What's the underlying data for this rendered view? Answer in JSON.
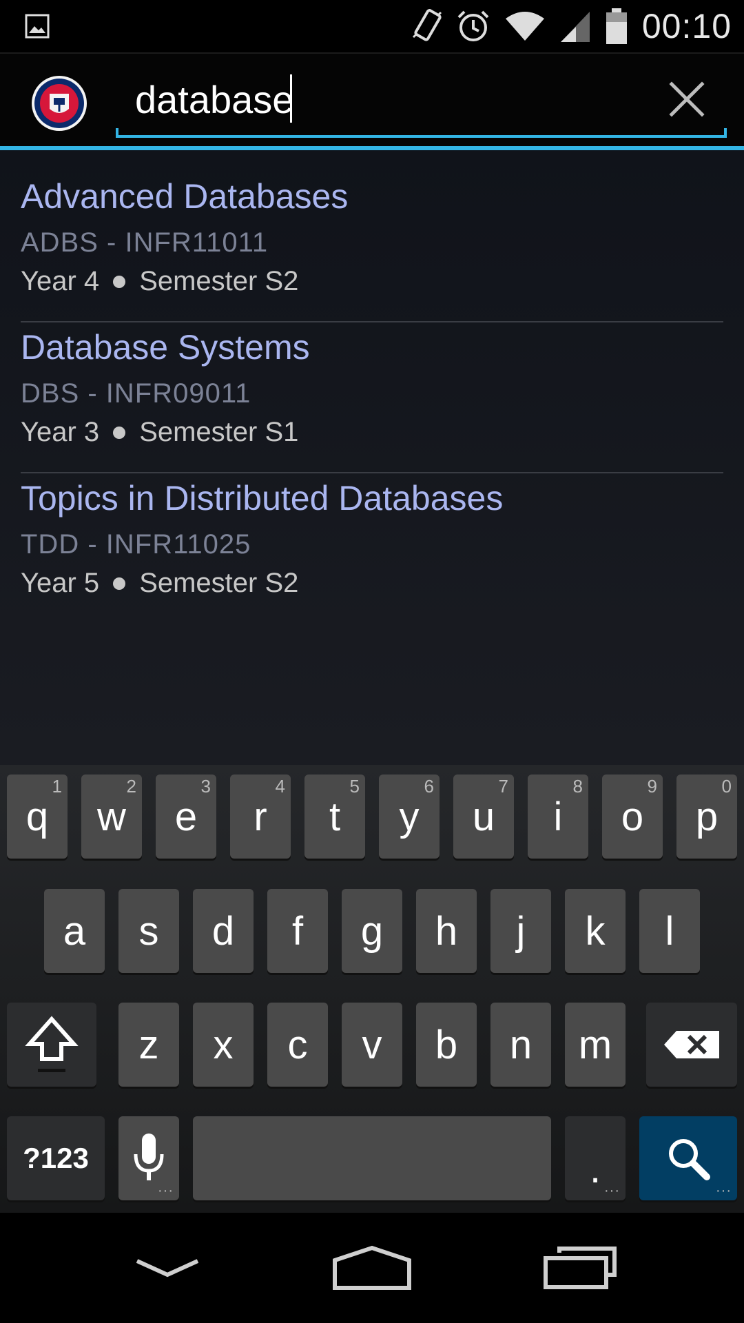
{
  "status_bar": {
    "time": "00:10",
    "icons": [
      "image-notification-icon",
      "vibrate-icon",
      "alarm-icon",
      "wifi-icon",
      "cell-signal-icon",
      "battery-icon"
    ]
  },
  "action_bar": {
    "logo": "university-of-edinburgh-crest",
    "search": {
      "value": "database",
      "placeholder": ""
    },
    "clear_icon": "close-icon",
    "accent_color": "#33b5e5"
  },
  "results": [
    {
      "title": "Advanced Databases",
      "code": "ADBS - INFR11011",
      "year": "Year 4",
      "semester": "Semester S2"
    },
    {
      "title": "Database Systems",
      "code": "DBS - INFR09011",
      "year": "Year 3",
      "semester": "Semester S1"
    },
    {
      "title": "Topics in Distributed Databases",
      "code": "TDD - INFR11025",
      "year": "Year 5",
      "semester": "Semester S2"
    }
  ],
  "keyboard": {
    "row1": [
      {
        "k": "q",
        "h": "1"
      },
      {
        "k": "w",
        "h": "2"
      },
      {
        "k": "e",
        "h": "3"
      },
      {
        "k": "r",
        "h": "4"
      },
      {
        "k": "t",
        "h": "5"
      },
      {
        "k": "y",
        "h": "6"
      },
      {
        "k": "u",
        "h": "7"
      },
      {
        "k": "i",
        "h": "8"
      },
      {
        "k": "o",
        "h": "9"
      },
      {
        "k": "p",
        "h": "0"
      }
    ],
    "row2": [
      "a",
      "s",
      "d",
      "f",
      "g",
      "h",
      "j",
      "k",
      "l"
    ],
    "row3": [
      "z",
      "x",
      "c",
      "v",
      "b",
      "n",
      "m"
    ],
    "symbols_label": "?123",
    "period_label": ".",
    "search_key_color": "#023e63"
  },
  "nav_bar": {
    "icons": [
      "back-icon",
      "home-icon",
      "recent-apps-icon"
    ]
  }
}
